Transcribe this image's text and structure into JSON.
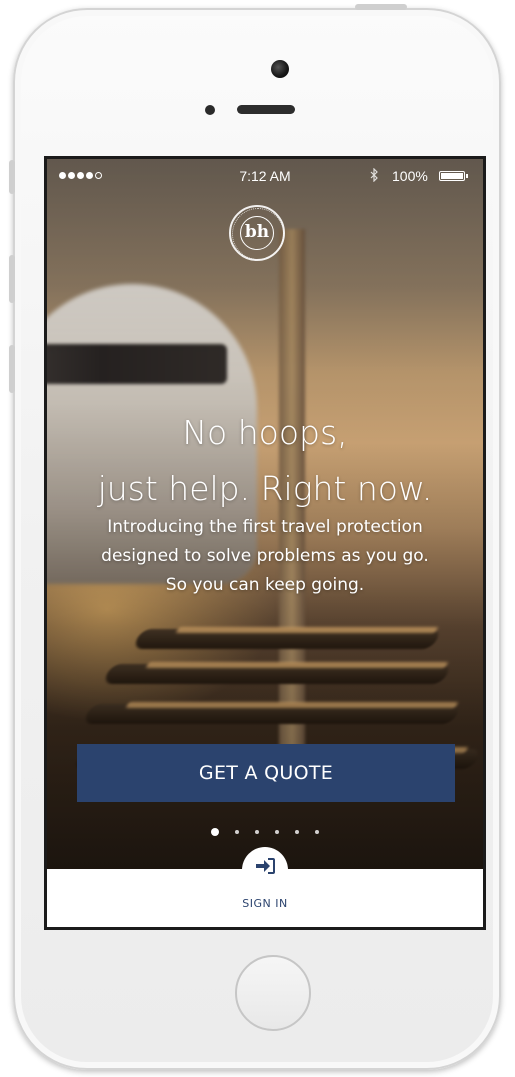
{
  "status_bar": {
    "signal_dots_filled": 4,
    "signal_dots_total": 5,
    "time": "7:12 AM",
    "bluetooth_icon": "bluetooth-icon",
    "battery_percent": "100%",
    "battery_level": 1.0
  },
  "logo": {
    "mark": "bh",
    "icon": "brand-seal-logo"
  },
  "hero": {
    "headline_line1": "No hoops,",
    "headline_line2": "just help. Right now.",
    "sub_line1": "Introducing the first travel protection",
    "sub_line2": "designed to solve problems as you go.",
    "sub_line3": "So you can keep going."
  },
  "cta": {
    "label": "GET A QUOTE",
    "color": "#2b436e"
  },
  "pagination": {
    "total": 6,
    "active_index": 0
  },
  "signin": {
    "label": "SIGN IN",
    "icon": "sign-in-arrow-icon"
  }
}
